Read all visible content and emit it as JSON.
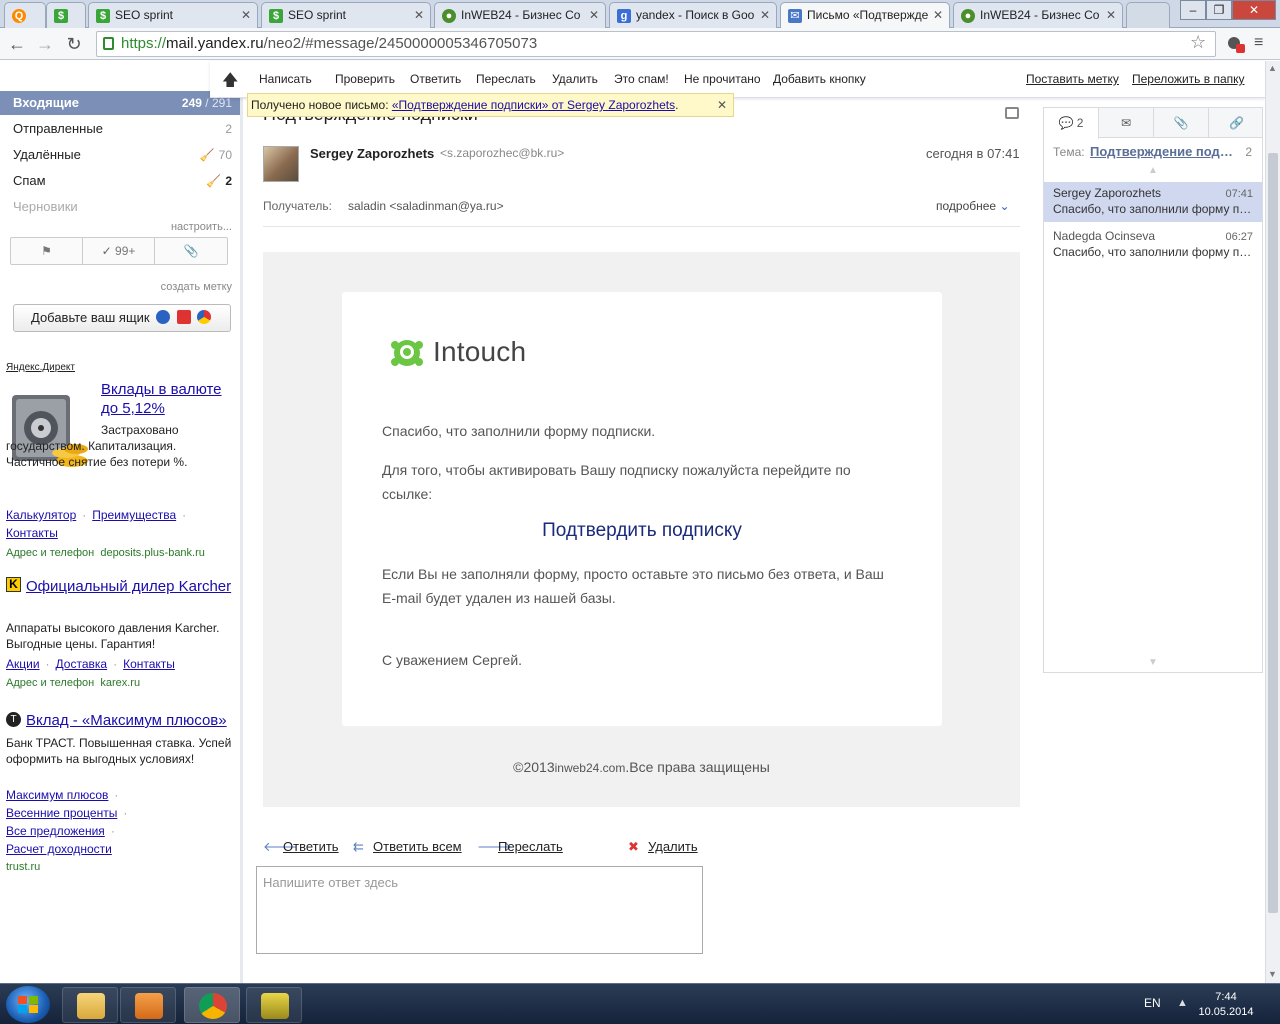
{
  "browser": {
    "tabs": [
      {
        "title": "",
        "icon": "yandex-icon",
        "color": "#ff8a00"
      },
      {
        "title": "",
        "icon": "seo-sprint-icon",
        "color": "#3aa63a"
      },
      {
        "title": "SEO sprint",
        "icon": "seo-sprint-icon",
        "color": "#3aa63a"
      },
      {
        "title": "SEO sprint",
        "icon": "seo-sprint-icon",
        "color": "#3aa63a"
      },
      {
        "title": "InWEB24 - Бизнес Со",
        "icon": "inweb-icon",
        "color": "#4a8f2a"
      },
      {
        "title": "yandex - Поиск в Goo",
        "icon": "google-icon",
        "color": "#3b6fd6"
      },
      {
        "title": "Письмо «Подтвержде",
        "icon": "mail-icon",
        "color": "#4a78c9"
      },
      {
        "title": "InWEB24 - Бизнес Со",
        "icon": "inweb-icon",
        "color": "#4a8f2a"
      }
    ],
    "url_scheme": "https://",
    "url_host": "mail.yandex.ru",
    "url_path": "/neo2/#message/2450000005346705073"
  },
  "sidebar": {
    "folders": [
      {
        "label": "Входящие",
        "unread": "249",
        "total": "291"
      },
      {
        "label": "Отправленные",
        "count": "2"
      },
      {
        "label": "Удалённые",
        "count": "70"
      },
      {
        "label": "Спам",
        "count": "2"
      },
      {
        "label": "Черновики",
        "count": ""
      }
    ],
    "configure": "настроить...",
    "filter_count": "99+",
    "create_label": "создать метку",
    "add_box": "Добавьте ваш ящик"
  },
  "ads": {
    "direct_label": "Яндекс.Директ",
    "ad1": {
      "title": "Вклады в валюте до 5,12%",
      "text": "Застраховано государством. Капитализация. Частичное снятие без потери %.",
      "links": [
        "Калькулятор",
        "Преимущества",
        "Контакты"
      ],
      "domain_label": "Адрес и телефон",
      "domain": "deposits.plus-bank.ru"
    },
    "ad2": {
      "title": "Официальный дилер Karcher",
      "text": "Аппараты высокого давления Karcher. Выгодные цены. Гарантия!",
      "links": [
        "Акции",
        "Доставка",
        "Контакты"
      ],
      "domain_label": "Адрес и телефон",
      "domain": "karex.ru"
    },
    "ad3": {
      "title": "Вклад - «Максимум плюсов»",
      "text": "Банк ТРАСТ. Повышенная ставка. Успей оформить на выгодных условиях!",
      "links": [
        "Максимум плюсов",
        "Весенние проценты",
        "Все предложения",
        "Расчет доходности"
      ],
      "domain": "trust.ru"
    }
  },
  "toolbar": {
    "compose": "Написать",
    "check": "Проверить",
    "reply": "Ответить",
    "forward": "Переслать",
    "delete": "Удалить",
    "spam": "Это спам!",
    "unread": "Не прочитано",
    "add_button": "Добавить кнопку",
    "label": "Поставить метку",
    "move": "Переложить в папку"
  },
  "notification": {
    "prefix": "Получено новое письмо:",
    "link": "«Подтверждение подписки» от Sergey Zaporozhets",
    "suffix": "."
  },
  "message": {
    "subject": "Подтверждение подписки",
    "sender_name": "Sergey Zaporozhets",
    "sender_email": "<s.zaporozhec@bk.ru>",
    "date": "сегодня в 07:41",
    "recipient_label": "Получатель:",
    "recipient": "saladin <saladinman@ya.ru>",
    "more": "подробнее"
  },
  "email_body": {
    "logo_text": "Intouch",
    "p1": "Спасибо, что заполнили форму подписки.",
    "p2": "Для того, чтобы активировать Вашу подписку пожалуйста перейдите по ссылке:",
    "confirm_link": "Подтвердить подписку",
    "p3": "Если Вы не заполняли форму, просто оставьте это письмо без ответа, и Ваш E-mail будет удален из нашей базы.",
    "p4": "С уважением Сергей.",
    "footer_year": "©2013",
    "footer_domain": "inweb24.com",
    "footer_rights": ".Все права защищены"
  },
  "actions": {
    "reply": "Ответить",
    "reply_all": "Ответить всем",
    "forward": "Переслать",
    "delete": "Удалить",
    "reply_placeholder": "Напишите ответ здесь"
  },
  "thread": {
    "tab_count": "2",
    "topic_label": "Тема:",
    "topic": "Подтверждение подписки",
    "topic_count": "2",
    "items": [
      {
        "name": "Sergey Zaporozhets",
        "time": "07:41",
        "snippet": "Спасибо, что заполнили форму подписки."
      },
      {
        "name": "Nadegda Ocinseva",
        "time": "06:27",
        "snippet": "Спасибо, что заполнили форму подписки."
      }
    ]
  },
  "taskbar": {
    "lang": "EN",
    "time": "7:44",
    "date": "10.05.2014"
  },
  "colors": {
    "inbox_bg": "#7b8fb7",
    "thread_selected": "#cfd8ee",
    "intouch_green": "#6cc644",
    "link": "#1a0dab"
  }
}
